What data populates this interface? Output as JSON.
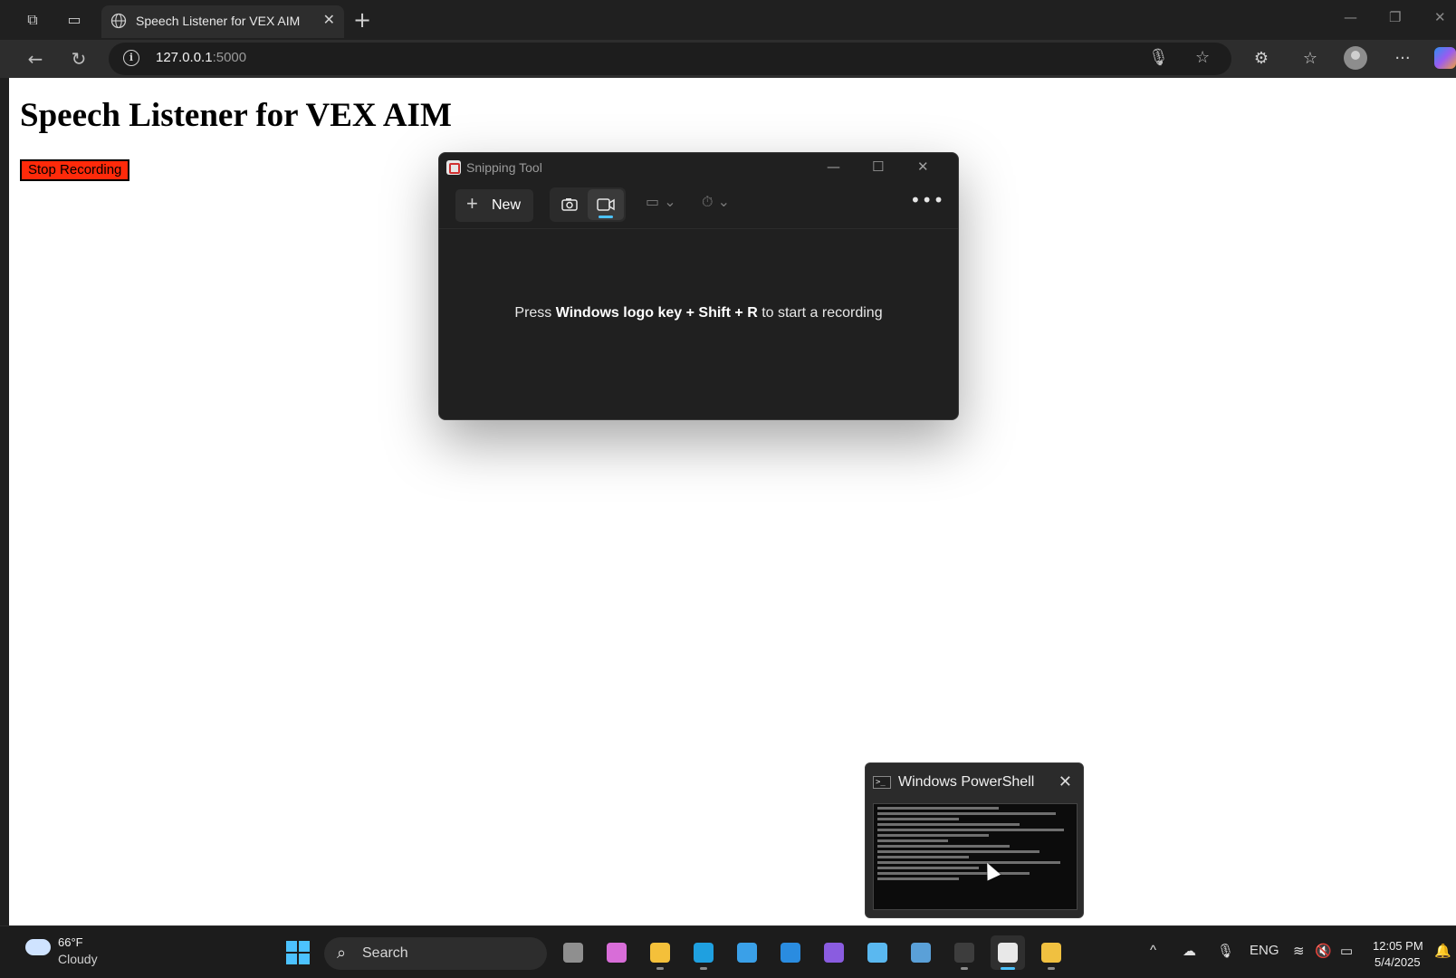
{
  "browser": {
    "tab": {
      "title": "Speech Listener for VEX AIM"
    },
    "address": {
      "host": "127.0.0.1",
      "port": ":5000"
    }
  },
  "page": {
    "title": "Speech Listener for VEX AIM",
    "stop_button": "Stop Recording"
  },
  "snipping_tool": {
    "title": "Snipping Tool",
    "new_label": "New",
    "message": {
      "prefix": "Press ",
      "keys": "Windows logo key + Shift + R",
      "suffix": " to start a recording"
    }
  },
  "taskbar_preview": {
    "title": "Windows PowerShell"
  },
  "taskbar": {
    "weather": {
      "temp": "66°F",
      "condition": "Cloudy"
    },
    "search_label": "Search",
    "language": "ENG",
    "time": "12:05 PM",
    "date": "5/4/2025",
    "apps": [
      {
        "name": "task-view",
        "color": "#8f8f8f"
      },
      {
        "name": "copilot",
        "color": "#d86dd8"
      },
      {
        "name": "file-explorer",
        "color": "#f4c03a"
      },
      {
        "name": "edge",
        "color": "#1fa0e0"
      },
      {
        "name": "microsoft-store",
        "color": "#3aa0e8"
      },
      {
        "name": "vscode",
        "color": "#2a8ce0"
      },
      {
        "name": "visual-studio",
        "color": "#8a5ce0"
      },
      {
        "name": "m365",
        "color": "#5ab8f0"
      },
      {
        "name": "snipping-tool-app",
        "color": "#5aa0d8"
      },
      {
        "name": "terminal",
        "color": "#3d3d3d"
      },
      {
        "name": "snipping-tool",
        "color": "#e8e8e8"
      },
      {
        "name": "python",
        "color": "#f0c040"
      }
    ]
  },
  "colors": {
    "accent": "#4cc2ff",
    "stop_button": "#ff2a0a"
  }
}
